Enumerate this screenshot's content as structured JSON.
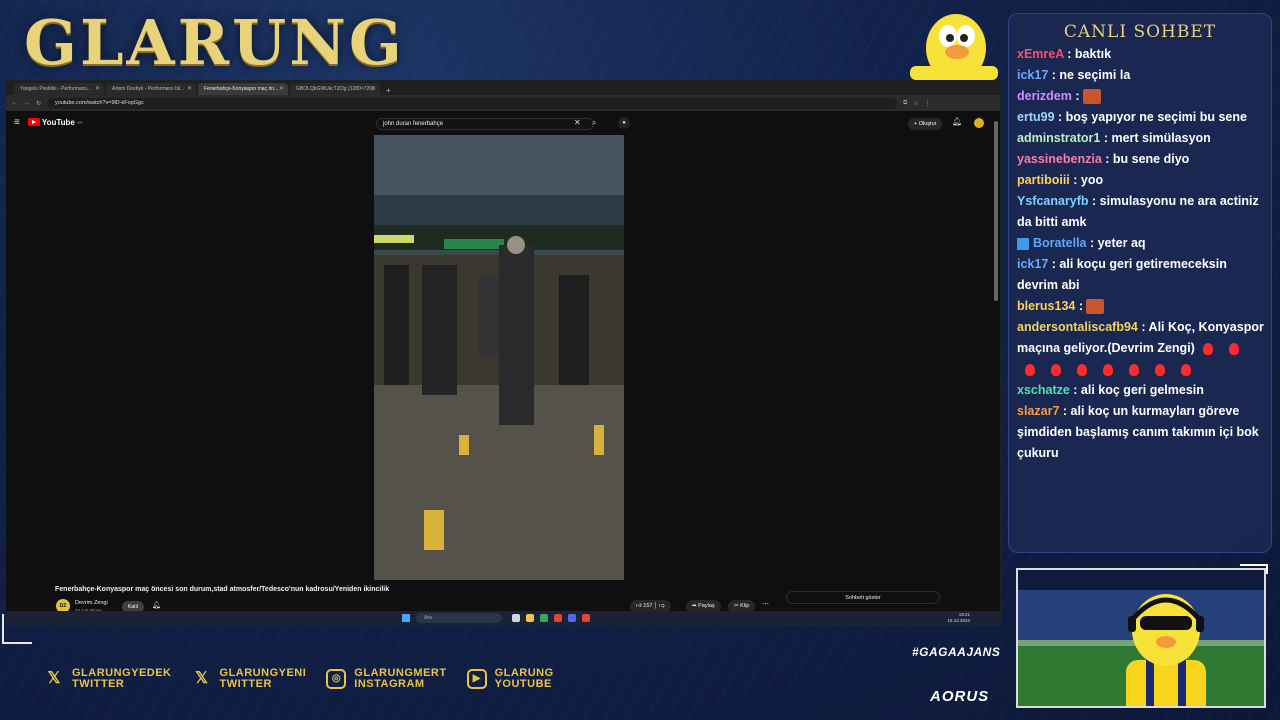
{
  "overlay": {
    "logo": "GLARUNG",
    "hashtag": "#GAGAAJANS",
    "sponsor": "AORUS",
    "socials": [
      {
        "icon": "x-icon",
        "line1": "GLARUNGYEDEK",
        "line2": "TWITTER"
      },
      {
        "icon": "x-icon",
        "line1": "GLARUNGYENI",
        "line2": "TWITTER"
      },
      {
        "icon": "instagram-icon",
        "line1": "GLARUNGMERT",
        "line2": "INSTAGRAM"
      },
      {
        "icon": "youtube-icon",
        "line1": "GLARUNG",
        "line2": "YOUTUBE"
      }
    ]
  },
  "browser": {
    "tabs": [
      {
        "label": "Yangelo Pavlidis - Performans..."
      },
      {
        "label": "Artem Dovbyk - Performans bil..."
      },
      {
        "label": "Fenerbahçe-Konyaspor maç ön...",
        "active": true
      },
      {
        "label": "GBOLQbGWUkcTZOg (1280×720)"
      }
    ],
    "new_tab": "+",
    "url": "youtube.com/watch?v=9lD-kFopGgc"
  },
  "youtube": {
    "brand": "YouTube",
    "brand_sup": "TR",
    "search_value": "john duran fenerbahçe",
    "create_label": "Oluştur",
    "video_title": "Fenerbahçe-Konyaspor maç öncesi son durum,stad atmosfer/Tedesco'nun kadrosu/Yeniden ikincilik",
    "channel_name": "Devrim Zengi",
    "channel_initials": "DZ",
    "subscribers": "44,4 B abone",
    "join_label": "Katıl",
    "likes": "157",
    "share_label": "Paylaş",
    "clip_label": "Klip",
    "show_chat_label": "Sohbeti göster"
  },
  "taskbar": {
    "search_placeholder": "Ara",
    "time": "19:21",
    "date": "15.12.2023"
  },
  "chat": {
    "title": "CANLI SOHBET",
    "messages": [
      {
        "user": "xEmreA",
        "color": "#ff4d6d",
        "text": "baktık"
      },
      {
        "user": "ick17",
        "color": "#6aa9ff",
        "text": "ne seçimi la"
      },
      {
        "user": "derizdem",
        "color": "#d68cff",
        "text": "",
        "emote": true
      },
      {
        "user": "ertu99",
        "color": "#9ad7ff",
        "text": "boş yapıyor ne seçimi bu sene"
      },
      {
        "user": "adminstrator1",
        "color": "#b8f0c8",
        "text": "mert simülasyon"
      },
      {
        "user": "yassinebenzia",
        "color": "#ff7aa8",
        "text": "bu sene diyo"
      },
      {
        "user": "partiboiii",
        "color": "#ffd166",
        "text": "yoo"
      },
      {
        "user": "Ysfcanaryfb",
        "color": "#7fd1ff",
        "text": "simulasyonu ne ara actiniz da bitti amk"
      },
      {
        "user": "Boratella",
        "color": "#5fa8ff",
        "text": "yeter aq",
        "badge": true
      },
      {
        "user": "ick17",
        "color": "#6aa9ff",
        "text": "ali koçu geri getiremeceksin devrim abi"
      },
      {
        "user": "blerus134",
        "color": "#ffcf5c",
        "text": "",
        "emote": true
      },
      {
        "user": "andersontaliscafb94",
        "color": "#f4d35e",
        "text": "Ali Koç, Konyaspor maçına geliyor.(Devrim Zengi)",
        "hearts": 9
      },
      {
        "user": "xschatze",
        "color": "#4fe0b6",
        "text": "ali koç geri gelmesin"
      },
      {
        "user": "slazar7",
        "color": "#ff9a3c",
        "text": "ali koç un kurmayları göreve şimdiden başlamış canım takımın içi bok çukuru"
      }
    ]
  }
}
